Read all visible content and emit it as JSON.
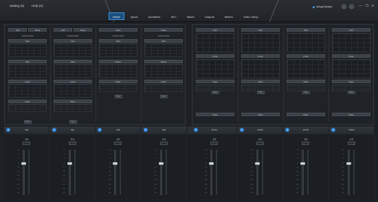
{
  "menu": {
    "settings": "Setting (S)",
    "help": "Help (H)"
  },
  "tabs": [
    {
      "label": "Home",
      "active": true
    },
    {
      "label": "Inputs",
      "active": false
    },
    {
      "label": "AutoMixer",
      "active": false
    },
    {
      "label": "AEC",
      "active": false
    },
    {
      "label": "Matrix",
      "active": false
    },
    {
      "label": "Outputs",
      "active": false
    },
    {
      "label": "Meters",
      "active": false
    },
    {
      "label": "Video Setup",
      "active": false
    }
  ],
  "device": {
    "label": "Virtual Device"
  },
  "window": {
    "minimize": "—",
    "restore": "❐",
    "close": "✕"
  },
  "colors": {
    "accent": "#2f86d8",
    "active_tab": "#1b4f80"
  },
  "inputs": [
    {
      "name": "IN1",
      "buttons": [
        "+48V",
        "Phase"
      ],
      "signal": "Analog signal",
      "blocks": [
        "Filter",
        "PEQ",
        "Limiter",
        "Delay"
      ],
      "small": "Freq",
      "gain": "0.0"
    },
    {
      "name": "IN2",
      "buttons": [
        "+48V",
        "Phase"
      ],
      "signal": "Analog signal",
      "blocks": [
        "Filter",
        "PEQ",
        "Limiter",
        "Delay"
      ],
      "small": "Freq",
      "gain": "0.0"
    },
    {
      "name": "IN3",
      "buttons": [
        "Phase"
      ],
      "signal": "Analog signal",
      "blocks": [
        "PEQ",
        "Ducker",
        "Delay"
      ],
      "small": "Freq",
      "gain": "0.0"
    },
    {
      "name": "IN4",
      "buttons": [
        "Phase"
      ],
      "signal": "Analog signal",
      "blocks": [
        "PEQ",
        "Ducker",
        "Delay"
      ],
      "small": "Freq",
      "gain": "0.0"
    }
  ],
  "outputs": [
    {
      "name": "OUT1",
      "blocks": [
        "PEQ",
        "Limiter",
        "Delay",
        "Phase"
      ],
      "small": "Freq",
      "gain": "0.0"
    },
    {
      "name": "OUT2",
      "blocks": [
        "PEQ",
        "Limiter",
        "Delay",
        "Phase"
      ],
      "small": "Freq",
      "gain": "0.0"
    },
    {
      "name": "OUT3",
      "blocks": [
        "PEQ",
        "Limiter",
        "Delay",
        "Phase"
      ],
      "small": "Freq",
      "gain": "0.0"
    },
    {
      "name": "OUT4",
      "blocks": [
        "PEQ",
        "Limiter",
        "Delay",
        "Phase"
      ],
      "small": "Freq",
      "gain": "0.0"
    }
  ],
  "scale": [
    "12",
    "6",
    "0",
    "-6",
    "-12",
    "-18",
    "-24",
    "-30",
    "-40",
    "-50",
    "-60"
  ],
  "strip_icon": "power-icon"
}
